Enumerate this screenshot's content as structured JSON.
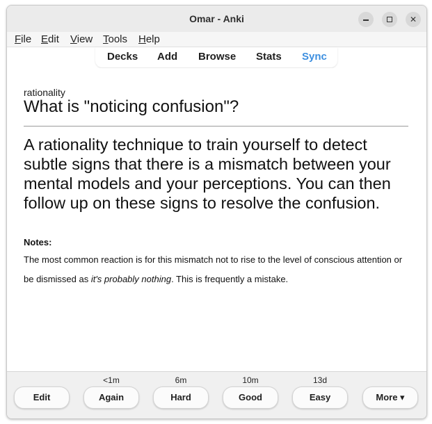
{
  "window": {
    "title": "Omar - Anki"
  },
  "menu": {
    "items": [
      {
        "first": "F",
        "rest": "ile"
      },
      {
        "first": "E",
        "rest": "dit"
      },
      {
        "first": "V",
        "rest": "iew"
      },
      {
        "first": "T",
        "rest": "ools"
      },
      {
        "first": "H",
        "rest": "elp"
      }
    ]
  },
  "toolbar": {
    "decks": "Decks",
    "add": "Add",
    "browse": "Browse",
    "stats": "Stats",
    "sync": "Sync",
    "sync_color": "#3d8fe0"
  },
  "card": {
    "deck_tag": "rationality",
    "question": "What is \"noticing confusion\"?",
    "answer": "A rationality technique to train yourself to detect subtle signs that there is a mismatch between your mental models and your perceptions. You can then follow up on these signs to resolve the confusion.",
    "notes_label": "Notes:",
    "notes_before": "The most common reaction is for this mismatch not to rise to the level of conscious attention or be dismissed as ",
    "notes_italic": "it's probably nothing",
    "notes_after": ". This is frequently a mistake."
  },
  "review": {
    "edit_label": "Edit",
    "more_label": "More ▾",
    "answers": [
      {
        "label": "Again",
        "interval": "<1m"
      },
      {
        "label": "Hard",
        "interval": "6m"
      },
      {
        "label": "Good",
        "interval": "10m"
      },
      {
        "label": "Easy",
        "interval": "13d"
      }
    ]
  },
  "icons": {
    "minimize": "minimize-icon",
    "maximize": "maximize-icon",
    "close": "close-icon"
  }
}
